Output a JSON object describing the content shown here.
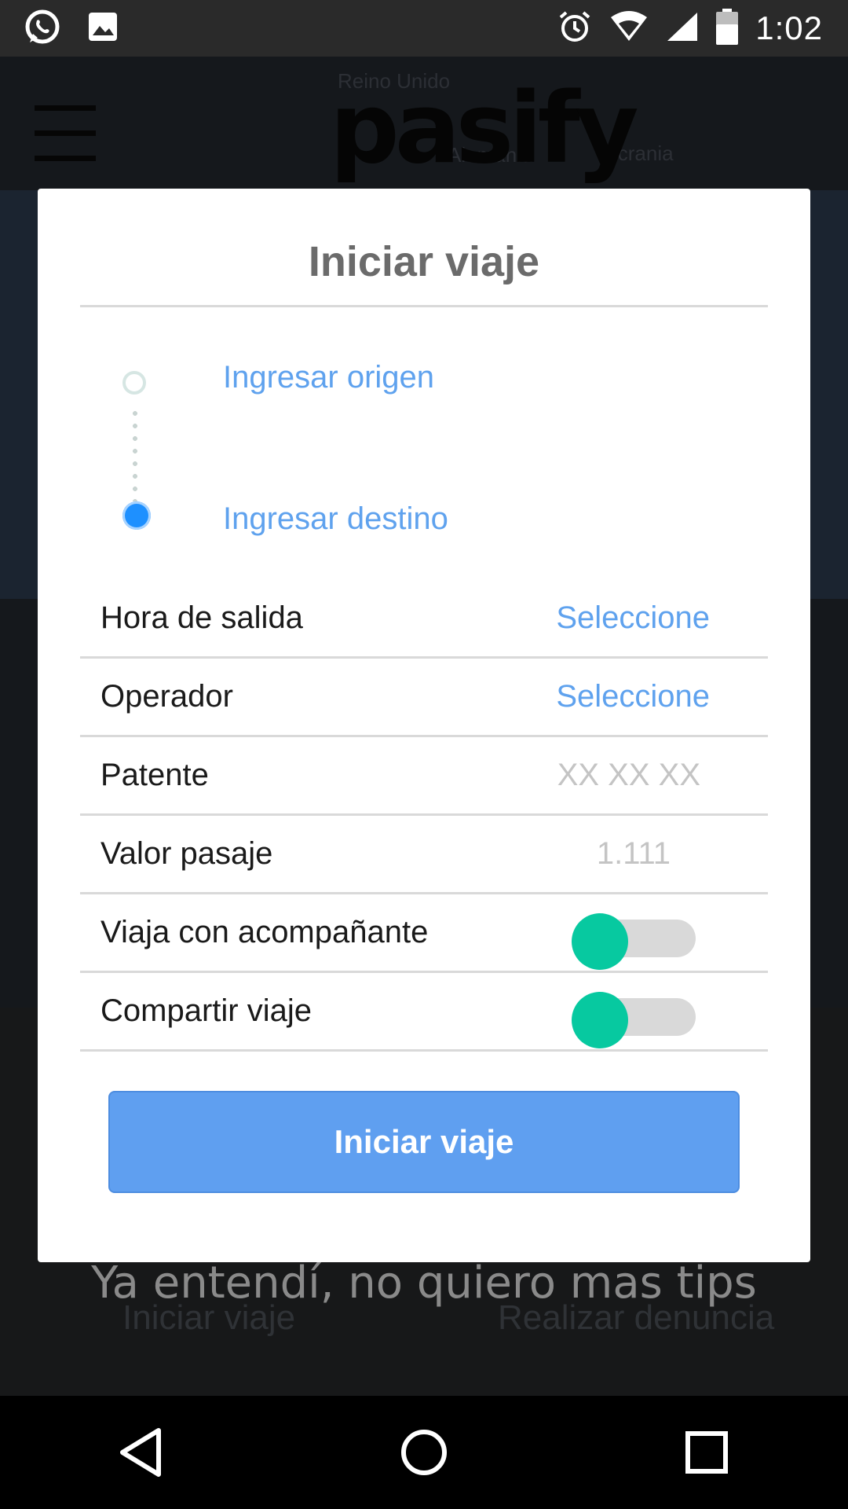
{
  "status_bar": {
    "time": "1:02",
    "icons": [
      "whatsapp-icon",
      "image-icon",
      "alarm-icon",
      "wifi-icon",
      "signal-icon",
      "battery-icon"
    ]
  },
  "app": {
    "logo_text": "pasify",
    "map_labels": [
      "Reino Unido",
      "Alemania",
      "Ucrania"
    ],
    "bottom_left_label": "Iniciar viaje",
    "bottom_right_label": "Realizar denuncia",
    "tips_text": "Ya entendí, no quiero mas tips"
  },
  "dialog": {
    "title": "Iniciar viaje",
    "route": {
      "origin_placeholder": "Ingresar origen",
      "destination_placeholder": "Ingresar destino"
    },
    "rows": [
      {
        "label": "Hora de salida",
        "value": "Seleccione"
      },
      {
        "label": "Operador",
        "value": "Seleccione"
      },
      {
        "label": "Patente",
        "placeholder": "XX XX XX"
      },
      {
        "label": "Valor pasaje",
        "placeholder": "1.111"
      },
      {
        "label": "Viaja con acompañante",
        "toggle_on": false
      },
      {
        "label": "Compartir viaje",
        "toggle_on": false
      }
    ],
    "primary_button": "Iniciar viaje"
  },
  "colors": {
    "accent_blue": "#5f9ff0",
    "link_blue": "#5fa2ee",
    "toggle_thumb": "#07c9a0",
    "destination_dot": "#1e90ff"
  }
}
